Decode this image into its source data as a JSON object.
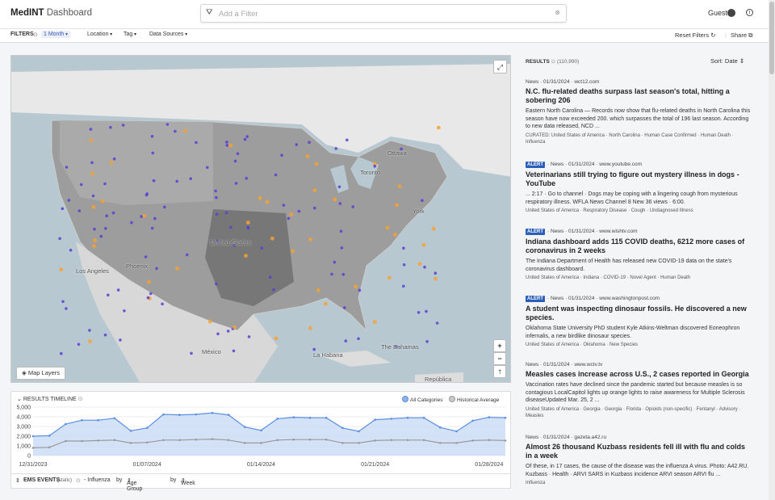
{
  "header": {
    "brand_main": "MedINT",
    "brand_sub": "Dashboard",
    "search_placeholder": "Add a Filter",
    "user_label": "Guest"
  },
  "filters": {
    "label": "FILTERS",
    "time": "1 Month",
    "location": "Location",
    "tag": "Tag",
    "sources": "Data Sources",
    "reset": "Reset Filters",
    "share": "Share"
  },
  "map": {
    "layers_button": "Map Layers",
    "labels": {
      "ottawa": "Ottawa",
      "toronto": "Toronto",
      "york": "York",
      "us": "United States",
      "phoenix": "Phoenix",
      "la": "Los Angeles",
      "mexico": "México",
      "havana": "La Habana",
      "bahamas": "The Bahamas",
      "dr": "República"
    }
  },
  "timeline": {
    "title": "RESULTS TIMELINE",
    "legend_all": "All Categories",
    "legend_hist": "Historical Average",
    "y_ticks": [
      "5,000",
      "4,000",
      "3,000",
      "2,000",
      "1,000",
      "0"
    ],
    "x_ticks": [
      "12/31/2023",
      "01/07/2024",
      "01/14/2024",
      "01/21/2024",
      "01/28/2024"
    ]
  },
  "chart_data": {
    "type": "line",
    "ylim": [
      0,
      5000
    ],
    "y_ticks": [
      0,
      1000,
      2000,
      3000,
      4000,
      5000
    ],
    "x_ticks": [
      "12/31/2023",
      "01/07/2024",
      "01/14/2024",
      "01/21/2024",
      "01/28/2024"
    ],
    "legend": "top-right",
    "series": [
      {
        "name": "All Categories",
        "color": "#5b8fe0",
        "values": [
          2000,
          2050,
          3250,
          3650,
          3650,
          3850,
          2550,
          2850,
          4250,
          4200,
          4250,
          4400,
          4200,
          2950,
          2600,
          3800,
          3950,
          3900,
          3900,
          2850,
          2500,
          3700,
          3800,
          3900,
          3900,
          2900,
          2500,
          3600,
          3950,
          3900
        ]
      },
      {
        "name": "Historical Average",
        "color": "#999999",
        "values": [
          800,
          850,
          1500,
          1500,
          1550,
          1600,
          1300,
          1350,
          1600,
          1600,
          1650,
          1700,
          1600,
          1300,
          1300,
          1600,
          1650,
          1650,
          1650,
          1300,
          1300,
          1550,
          1600,
          1600,
          1600,
          1300,
          1300,
          1550,
          1600,
          1550
        ]
      }
    ]
  },
  "ems": {
    "label": "EMS EVENTS",
    "static": "(static)",
    "disease": "- Influenza",
    "by1": "by",
    "group": "Age Group",
    "by2": "by",
    "period": "Week"
  },
  "results": {
    "label": "RESULTS",
    "count": "(110,990)",
    "sort": "Sort: Date",
    "items": [
      {
        "alert": "",
        "meta": "News · 01/31/2024 · wct12.com",
        "title": "N.C. flu-related deaths surpass last season's total, hitting a sobering 206",
        "snippet": "Eastern North Carolina — Records now show that flu-related deaths in North Carolina this season have now exceeded 200. which surpasses the total of 196 last season. According to new data released, NCD ...",
        "tags": "CURATED: United States of America · North Carolina · Human Case Confirmed · Human Death · Influenza"
      },
      {
        "alert": "ALERT",
        "meta": "· News · 01/31/2024 · www.youtube.com",
        "title": "Veterinarians still trying to figure out mystery illness in dogs - YouTube",
        "snippet": "... 2:17 · Go to channel · Dogs may be coping with a lingering cough from mysterious respiratory illness. WFLA News Channel 8 New 36 views · 6:00.",
        "tags": "United States of America · Respiratory Disease · Cough · Undiagnosed Illness"
      },
      {
        "alert": "ALERT",
        "meta": "· News · 01/31/2024 · www.wishtv.com",
        "title": "Indiana dashboard adds 115 COVID deaths, 6212 more cases of coronavirus in 2 weeks",
        "snippet": "The Indiana Department of Health has released new COVID-19 data on the state's coronavirus dashboard.",
        "tags": "United States of America · Indiana · COVID-19 · Novel Agent · Human Death"
      },
      {
        "alert": "ALERT",
        "meta": "· News · 01/31/2024 · www.washingtonpost.com",
        "title": "A student was inspecting dinosaur fossils. He discovered a new species.",
        "snippet": "Oklahoma State University PhD student Kyle Atkins-Weltman discovered Eoneophron infernalis, a new birdlike dinosaur species.",
        "tags": "United States of America · Oklahoma · New Species"
      },
      {
        "alert": "",
        "meta": "News · 01/31/2024 · www.wctv.tv",
        "title": "Measles cases increase across U.S., 2 cases reported in Georgia",
        "snippet": "Vaccination rates have declined since the pandemic started but because measles is so contagious LocalCapitol lights up orange lights to raise awareness for Multiple Sclerosis diseaseUpdated Mar. 25, 2 ...",
        "tags": "United States of America · Georgia · Georgia · Florida · Opioids (non-specific) · Fentanyl · Advisory · Measles"
      },
      {
        "alert": "",
        "meta": "News · 01/31/2024 · gazeta.a42.ru",
        "title": "Almost 26 thousand Kuzbass residents fell ill with flu and colds in a week",
        "snippet": "Of these, in 17 cases, the cause of the disease was the influenza A virus. Photo: A42.RU. Kuzbass · Health · ARVI SARS in Kuzbass incidence ARVI season ARVI flu ...",
        "tags": "Influenza"
      }
    ]
  }
}
